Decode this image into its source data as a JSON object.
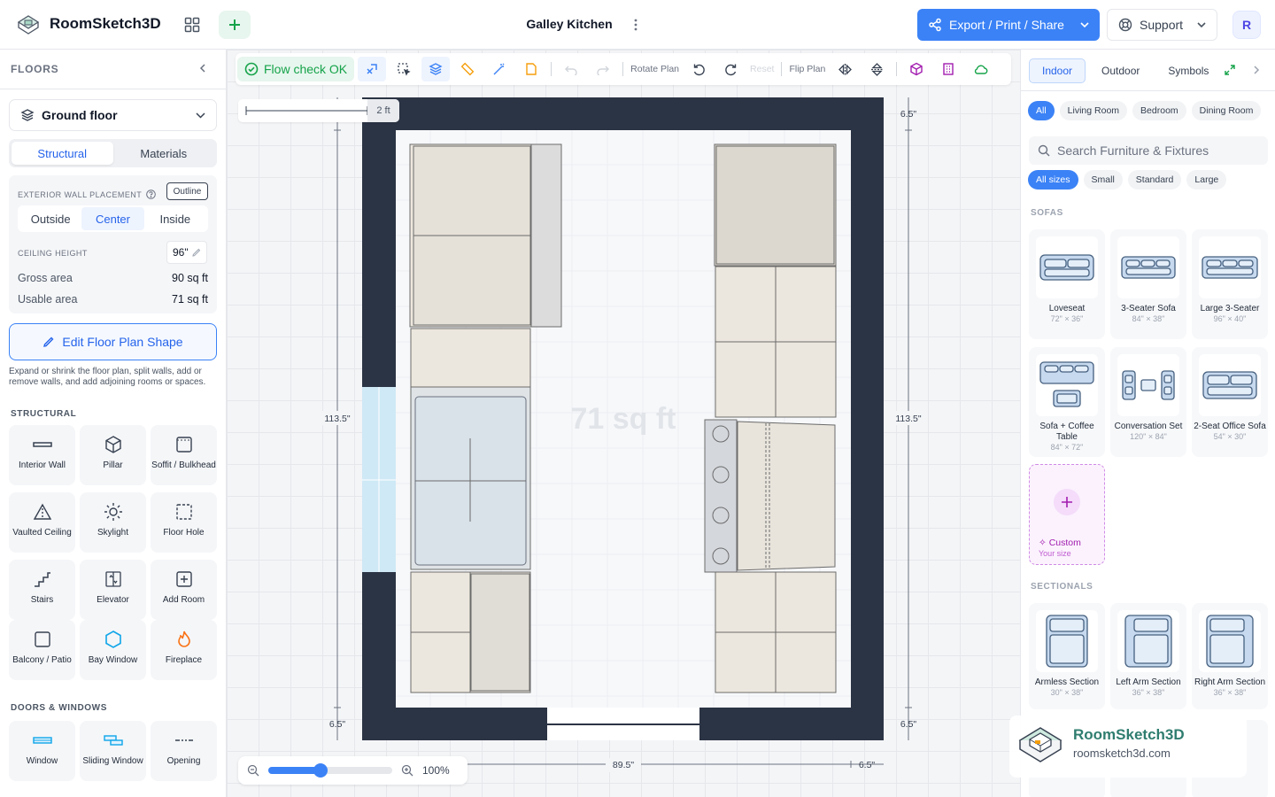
{
  "app": {
    "name": "RoomSketch3D",
    "doc_title": "Galley Kitchen"
  },
  "header": {
    "export_label": "Export / Print / Share",
    "support_label": "Support",
    "avatar_initial": "R"
  },
  "sidebar": {
    "heading": "FLOORS",
    "floor_selected": "Ground floor",
    "tabs": [
      "Structural",
      "Materials"
    ],
    "exterior_wall_label": "EXTERIOR WALL PLACEMENT",
    "outline_badge": "Outline",
    "placement_options": [
      "Outside",
      "Center",
      "Inside"
    ],
    "ceiling_label": "CEILING HEIGHT",
    "ceiling_value": "96\"",
    "gross_area_label": "Gross area",
    "gross_area_value": "90 sq ft",
    "usable_area_label": "Usable area",
    "usable_area_value": "71 sq ft",
    "edit_shape_label": "Edit Floor Plan Shape",
    "helper_text": "Expand or shrink the floor plan, split walls, add or remove walls, and add adjoining rooms or spaces.",
    "structural_heading": "STRUCTURAL",
    "structural_items": [
      "Interior Wall",
      "Pillar",
      "Soffit / Bulkhead",
      "Vaulted Ceiling",
      "Skylight",
      "Floor Hole",
      "Stairs",
      "Elevator",
      "Add Room",
      "Balcony / Patio",
      "Bay Window",
      "Fireplace"
    ],
    "doors_heading": "DOORS & WINDOWS",
    "door_items": [
      "Window",
      "Sliding Window",
      "Opening"
    ]
  },
  "toolbar": {
    "flow_check": "Flow check OK",
    "rotate_label": "Rotate Plan",
    "reset_label": "Reset",
    "flip_label": "Flip Plan"
  },
  "canvas": {
    "scale_label": "2 ft",
    "area_watermark": "71 sq ft",
    "dims": {
      "height": "113.5\"",
      "wall": "6.5\"",
      "width": "89.5\""
    },
    "zoom_level": 0.42,
    "zoom_label": "100%"
  },
  "right_panel": {
    "tabs": [
      "Indoor",
      "Outdoor",
      "Symbols"
    ],
    "room_filters": [
      "All",
      "Living Room",
      "Bedroom",
      "Dining Room"
    ],
    "search_placeholder": "Search Furniture & Fixtures",
    "size_filters": [
      "All sizes",
      "Small",
      "Standard",
      "Large"
    ],
    "sofas_heading": "SOFAS",
    "sofas": [
      {
        "name": "Loveseat",
        "size": "72\" × 36\""
      },
      {
        "name": "3-Seater Sofa",
        "size": "84\" × 38\""
      },
      {
        "name": "Large 3-Seater",
        "size": "96\" × 40\""
      },
      {
        "name": "Sofa + Coffee Table",
        "size": "84\" × 72\""
      },
      {
        "name": "Conversation Set",
        "size": "120\" × 84\""
      },
      {
        "name": "2-Seat Office Sofa",
        "size": "54\" × 30\""
      }
    ],
    "custom": {
      "label": "Custom",
      "sub": "Your size"
    },
    "sectionals_heading": "SECTIONALS",
    "sectionals": [
      {
        "name": "Armless Section",
        "size": "30\" × 38\""
      },
      {
        "name": "Left Arm Section",
        "size": "36\" × 38\""
      },
      {
        "name": "Right Arm Section",
        "size": "36\" × 38\""
      }
    ]
  },
  "watermark": {
    "name": "RoomSketch3D",
    "url": "roomsketch3d.com"
  },
  "colors": {
    "accent": "#3b82f6",
    "wall": "#2b3444",
    "ok": "#16a34a",
    "custom": "#a21caf"
  }
}
